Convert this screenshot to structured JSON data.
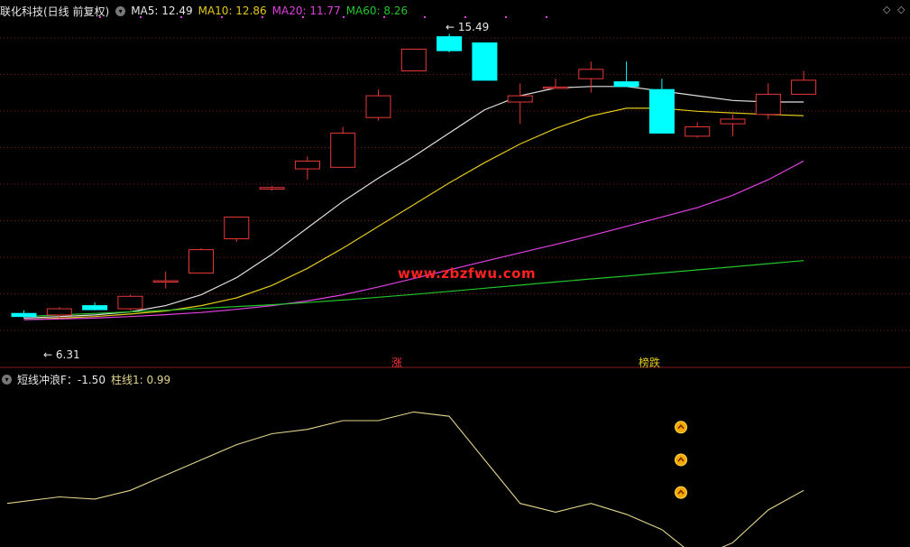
{
  "header_top": {
    "stock_title": "联化科技(日线 前复权)",
    "ma5_label": "MA5: 12.49",
    "ma10_label": "MA10: 12.86",
    "ma20_label": "MA20: 11.77",
    "ma60_label": "MA60: 8.26"
  },
  "header_bottom": {
    "indicator_label": "短线冲浪F：-1.50",
    "bar_label": "柱线1: 0.99"
  },
  "watermark": "www.zbzfwu.com",
  "colors": {
    "up": "#e8373a",
    "down": "#00ffff",
    "ma5": "#e0e0e0",
    "ma10": "#e2c81a",
    "ma20": "#e040e0",
    "ma60": "#22c42a",
    "indicator": "#e2d48a",
    "grid": "#7a1c1c"
  },
  "chart_data": [
    {
      "type": "candlestick",
      "title": "联化科技(日线 前复权)",
      "ylim": [
        5.2,
        16.0
      ],
      "annotations": {
        "high": "15.49",
        "low": "6.31",
        "signal_up": "涨",
        "signal_down": "榜跌"
      },
      "candles": [
        {
          "o": 6.5,
          "h": 6.6,
          "l": 6.35,
          "c": 6.4
        },
        {
          "o": 6.45,
          "h": 6.7,
          "l": 6.31,
          "c": 6.65
        },
        {
          "o": 6.75,
          "h": 6.85,
          "l": 6.6,
          "c": 6.62
        },
        {
          "o": 6.65,
          "h": 7.1,
          "l": 6.6,
          "c": 7.05
        },
        {
          "o": 7.55,
          "h": 7.85,
          "l": 7.3,
          "c": 7.55
        },
        {
          "o": 7.8,
          "h": 8.6,
          "l": 7.8,
          "c": 8.55
        },
        {
          "o": 8.9,
          "h": 9.6,
          "l": 8.8,
          "c": 9.6
        },
        {
          "o": 10.5,
          "h": 10.6,
          "l": 10.45,
          "c": 10.55
        },
        {
          "o": 11.15,
          "h": 11.55,
          "l": 10.8,
          "c": 11.4
        },
        {
          "o": 11.2,
          "h": 12.5,
          "l": 11.2,
          "c": 12.3
        },
        {
          "o": 12.8,
          "h": 13.7,
          "l": 12.7,
          "c": 13.5
        },
        {
          "o": 14.3,
          "h": 14.3,
          "l": 14.3,
          "c": 15.0
        },
        {
          "o": 15.4,
          "h": 15.49,
          "l": 14.9,
          "c": 14.95
        },
        {
          "o": 15.2,
          "h": 15.2,
          "l": 14.0,
          "c": 14.0
        },
        {
          "o": 13.3,
          "h": 13.9,
          "l": 12.6,
          "c": 13.5
        },
        {
          "o": 13.78,
          "h": 14.05,
          "l": 13.78,
          "c": 13.78
        },
        {
          "o": 14.05,
          "h": 14.6,
          "l": 13.6,
          "c": 14.35
        },
        {
          "o": 13.95,
          "h": 14.6,
          "l": 13.8,
          "c": 13.8
        },
        {
          "o": 13.7,
          "h": 14.05,
          "l": 12.3,
          "c": 12.3
        },
        {
          "o": 12.2,
          "h": 12.65,
          "l": 12.15,
          "c": 12.5
        },
        {
          "o": 12.6,
          "h": 12.9,
          "l": 12.2,
          "c": 12.75
        },
        {
          "o": 12.9,
          "h": 13.9,
          "l": 12.75,
          "c": 13.55
        },
        {
          "o": 13.55,
          "h": 14.3,
          "l": 13.55,
          "c": 14.0
        }
      ],
      "series": [
        {
          "name": "MA5",
          "values": [
            6.35,
            6.4,
            6.45,
            6.55,
            6.75,
            7.1,
            7.65,
            8.4,
            9.25,
            10.1,
            10.85,
            11.55,
            12.3,
            13.05,
            13.5,
            13.75,
            13.8,
            13.8,
            13.65,
            13.5,
            13.35,
            13.3,
            13.3
          ]
        },
        {
          "name": "MA10",
          "values": [
            6.3,
            6.35,
            6.4,
            6.48,
            6.58,
            6.75,
            7.0,
            7.4,
            7.95,
            8.6,
            9.3,
            10.0,
            10.7,
            11.35,
            11.95,
            12.45,
            12.85,
            13.1,
            13.1,
            13.0,
            12.95,
            12.9,
            12.86
          ]
        },
        {
          "name": "MA20",
          "values": [
            6.3,
            6.32,
            6.35,
            6.4,
            6.46,
            6.53,
            6.63,
            6.75,
            6.9,
            7.1,
            7.35,
            7.62,
            7.9,
            8.18,
            8.45,
            8.72,
            9.0,
            9.3,
            9.6,
            9.9,
            10.3,
            10.8,
            11.4
          ]
        },
        {
          "name": "MA60",
          "values": [
            6.4,
            6.45,
            6.5,
            6.55,
            6.6,
            6.66,
            6.72,
            6.78,
            6.85,
            6.93,
            7.02,
            7.11,
            7.21,
            7.31,
            7.41,
            7.51,
            7.61,
            7.7,
            7.8,
            7.9,
            8.0,
            8.1,
            8.2
          ]
        }
      ]
    },
    {
      "type": "line",
      "ylim": [
        -2.0,
        5.5
      ],
      "series": [
        {
          "name": "短线冲浪F",
          "values": [
            0.0,
            0.3,
            0.2,
            0.6,
            1.3,
            2.0,
            2.7,
            3.2,
            3.4,
            3.8,
            3.8,
            4.2,
            4.0,
            2.0,
            0.0,
            -0.4,
            0.0,
            -0.5,
            -1.2,
            -2.5,
            -1.8,
            -0.3,
            0.6
          ]
        }
      ],
      "signal_markers": [
        0.5,
        2.0,
        3.5
      ]
    }
  ]
}
